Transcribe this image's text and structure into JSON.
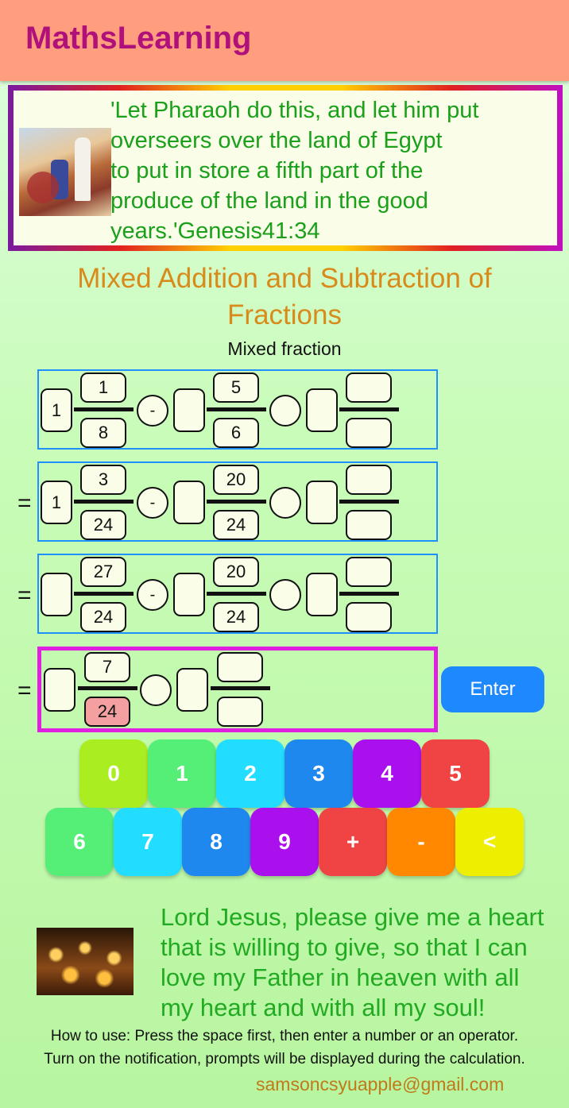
{
  "app": {
    "title": "MathsLearning"
  },
  "verse": {
    "lines": [
      "'Let Pharaoh do this, and let him put",
      "overseers over the land of Egypt",
      "to put in store a fifth part of the",
      "produce of the land in the good",
      "years.'Genesis41:34"
    ]
  },
  "heading": {
    "line1": "Mixed Addition and Subtraction of",
    "line2": "Fractions"
  },
  "subheading": "Mixed fraction",
  "rows": [
    {
      "eq": "",
      "t1": {
        "whole": "1",
        "num": "1",
        "den": "8"
      },
      "op1": "-",
      "t2": {
        "whole": "",
        "num": "5",
        "den": "6"
      },
      "op2": "",
      "t3": {
        "whole": "",
        "num": "",
        "den": ""
      }
    },
    {
      "eq": "=",
      "t1": {
        "whole": "1",
        "num": "3",
        "den": "24"
      },
      "op1": "-",
      "t2": {
        "whole": "",
        "num": "20",
        "den": "24"
      },
      "op2": "",
      "t3": {
        "whole": "",
        "num": "",
        "den": ""
      }
    },
    {
      "eq": "=",
      "t1": {
        "whole": "",
        "num": "27",
        "den": "24"
      },
      "op1": "-",
      "t2": {
        "whole": "",
        "num": "20",
        "den": "24"
      },
      "op2": "",
      "t3": {
        "whole": "",
        "num": "",
        "den": ""
      }
    }
  ],
  "answer": {
    "eq": "=",
    "t1": {
      "whole": "",
      "num": "7",
      "den": "24"
    },
    "op1": "",
    "t2": {
      "whole": "",
      "num": "",
      "den": ""
    }
  },
  "enter_label": "Enter",
  "keypad": {
    "row1": [
      {
        "label": "0",
        "color": "#aaee22"
      },
      {
        "label": "1",
        "color": "#55ee77"
      },
      {
        "label": "2",
        "color": "#22ddff"
      },
      {
        "label": "3",
        "color": "#1e88ee"
      },
      {
        "label": "4",
        "color": "#aa10ee"
      },
      {
        "label": "5",
        "color": "#f04444"
      }
    ],
    "row2": [
      {
        "label": "6",
        "color": "#55ee77"
      },
      {
        "label": "7",
        "color": "#22ddff"
      },
      {
        "label": "8",
        "color": "#1e88ee"
      },
      {
        "label": "9",
        "color": "#aa10ee"
      },
      {
        "label": "+",
        "color": "#f04444"
      },
      {
        "label": "-",
        "color": "#ff8800"
      },
      {
        "label": "<",
        "color": "#eeee00"
      }
    ]
  },
  "prayer": {
    "lines": [
      "Lord Jesus, please give me a heart",
      "that is willing to give, so that I can",
      "love my Father in heaven with all",
      "my heart and with all my soul!"
    ]
  },
  "howto": {
    "line1": "How to use: Press the space first, then enter a number or an operator.",
    "line2": "Turn on the notification, prompts will be displayed during the calculation."
  },
  "email": "samsoncsyuapple@gmail.com"
}
